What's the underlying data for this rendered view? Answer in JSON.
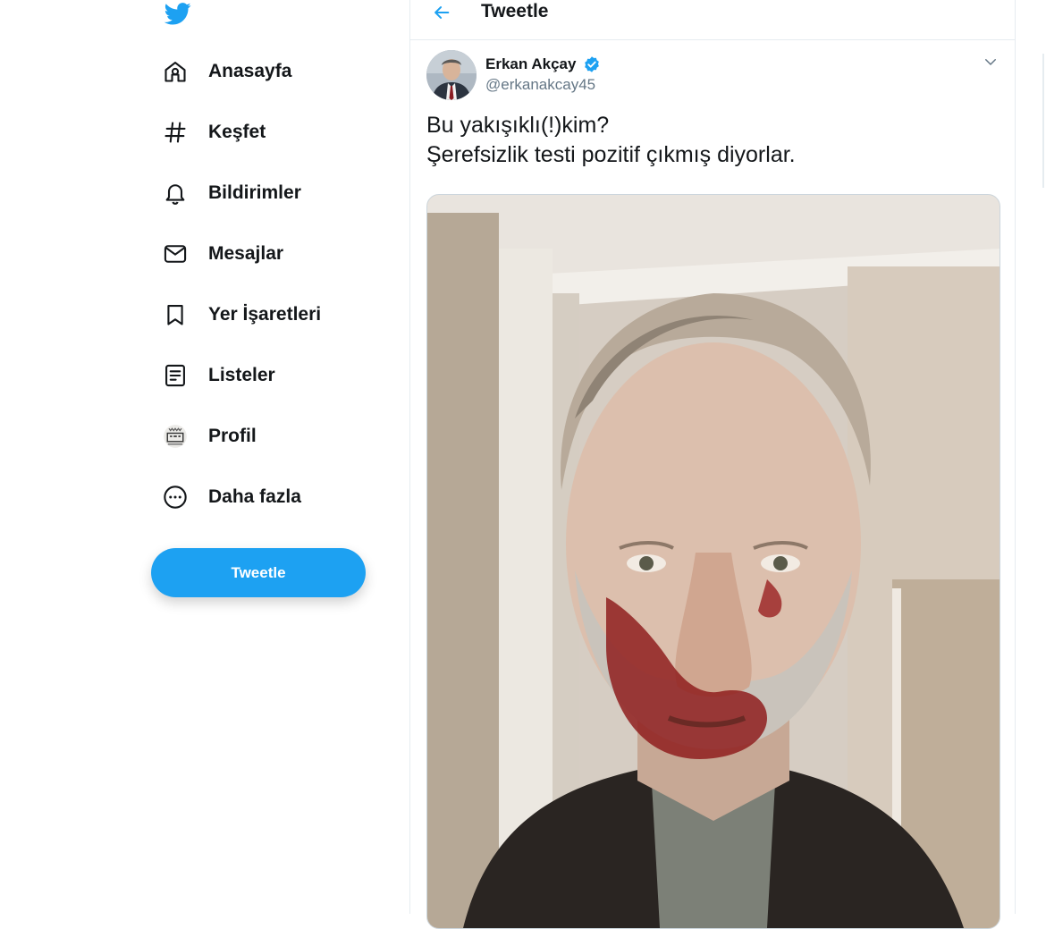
{
  "nav": {
    "items": [
      {
        "label": "Anasayfa",
        "icon": "home-icon"
      },
      {
        "label": "Keşfet",
        "icon": "hashtag-icon"
      },
      {
        "label": "Bildirimler",
        "icon": "bell-icon"
      },
      {
        "label": "Mesajlar",
        "icon": "envelope-icon"
      },
      {
        "label": "Yer İşaretleri",
        "icon": "bookmark-icon"
      },
      {
        "label": "Listeler",
        "icon": "list-icon"
      },
      {
        "label": "Profil",
        "icon": "profile-avatar-icon"
      },
      {
        "label": "Daha fazla",
        "icon": "more-circle-icon"
      }
    ],
    "tweet_button": "Tweetle"
  },
  "header": {
    "title": "Tweetle"
  },
  "tweet": {
    "author_name": "Erkan Akçay",
    "author_handle": "@erkanakcay45",
    "verified": true,
    "text_lines": [
      "Bu yakışıklı(!)kim?",
      "Şerefsizlik testi pozitif çıkmış diyorlar."
    ]
  },
  "colors": {
    "accent": "#1da1f2",
    "text": "#14171a",
    "secondary": "#657786",
    "border": "#e6ecf0"
  }
}
